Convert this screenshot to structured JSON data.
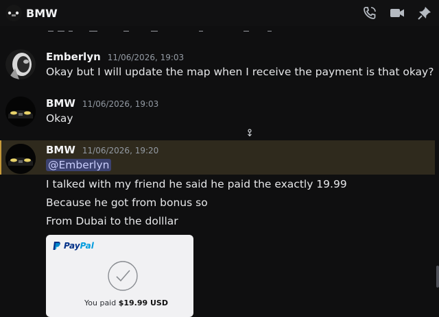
{
  "header": {
    "title": "BMW"
  },
  "messages": [
    {
      "author": "Emberlyn",
      "timestamp": "11/06/2026, 19:03",
      "lines": [
        "Okay but I will update the map when I receive the payment is that okay?"
      ]
    },
    {
      "author": "BMW",
      "timestamp": "11/06/2026, 19:03",
      "lines": [
        "Okay"
      ]
    },
    {
      "author": "BMW",
      "timestamp": "11/06/2026, 19:20",
      "mention": "@Emberlyn",
      "lines": [
        "I talked with my friend he said he paid the exactly 19.99",
        "Because he got from bonus so",
        "From Dubai to the dolllar"
      ],
      "attachment": {
        "brand_pay": "Pay",
        "brand_pal": "Pal",
        "paid_prefix": "You paid ",
        "paid_amount": "$19.99 USD"
      }
    }
  ],
  "colors": {
    "background": "#0f0f10",
    "highlight": "#2f2a1d",
    "mention": "#3c4270",
    "paypal_dark": "#003087",
    "paypal_light": "#009cde"
  },
  "icons": [
    "call-icon",
    "video-icon",
    "pin-icon",
    "check-circle-icon",
    "paypal-logo-icon"
  ]
}
